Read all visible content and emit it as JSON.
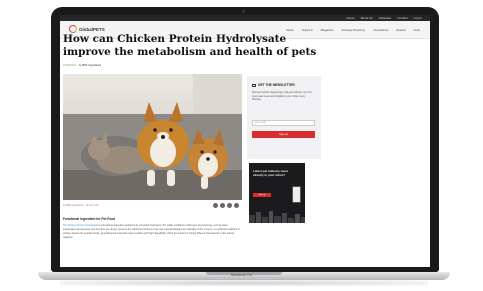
{
  "device": {
    "label": "MacBook Pro"
  },
  "site": {
    "utility_links": [
      "Home",
      "About Us",
      "Advertise",
      "Contact",
      "Log In"
    ],
    "logo_text": "GlobalPETS",
    "nav": [
      "News",
      "Topics ▾",
      "Magazine",
      "Industry Directory",
      "Innovations",
      "Events",
      "Jobs"
    ]
  },
  "article": {
    "title": "How can Chicken Protein Hydrolysate improve the metabolism and health of pets",
    "date": "07/09/2024",
    "byline": "by BRF Ingredients",
    "caption": "by BRF Ingredients · 10 min read",
    "section_heading": "Functional Ingredient for Pet Food",
    "link_text": "The Chicken Protein Hydrolysate",
    "body": " is a functional ingredient produced by enzymatic hydrolysis. The stable conditions of this type of processing, such as lower temperature and pressure and intensive pre-drying, preserve the nutritional richness of the raw material. Besides the utilization of the enzyme, it is optimal conditions of activity, cleaves the peptide bonds, generating low-molecular-mass peptides with high digestibility, which are known for having different biocosmetics in the animal organism."
  },
  "newsletter": {
    "title": "GET THE NEWSLETTER",
    "text": "Discover what's happening in the pet industry. Get the most read news and insights in your inbox every Monday.",
    "placeholder": "your email",
    "button": "Sign up"
  },
  "ad": {
    "text": "Latest pet industry news directly in your inbox?",
    "button": "Sign up"
  },
  "colors": {
    "accent": "#d62d2d",
    "link": "#3c8fd6",
    "date": "#6aa84f"
  }
}
